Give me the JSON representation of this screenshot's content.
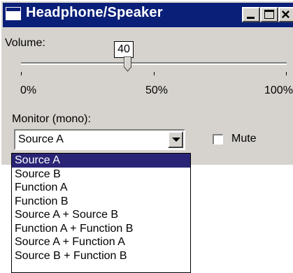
{
  "window": {
    "title": "Headphone/Speaker"
  },
  "volume": {
    "label": "Volume:",
    "value": "40",
    "percent": 40,
    "tick_labels": [
      "0%",
      "50%",
      "100%"
    ]
  },
  "monitor": {
    "label": "Monitor (mono):",
    "selected": "Source A",
    "options": [
      "Source A",
      "Source B",
      "Function A",
      "Function B",
      "Source A + Source B",
      "Function A + Function B",
      "Source A + Function A",
      "Source B + Function B"
    ]
  },
  "mute": {
    "label": "Mute",
    "checked": false
  },
  "colors": {
    "titlebar": "#0a1f78",
    "face": "#d6d3ce",
    "selection": "#2a2476"
  }
}
